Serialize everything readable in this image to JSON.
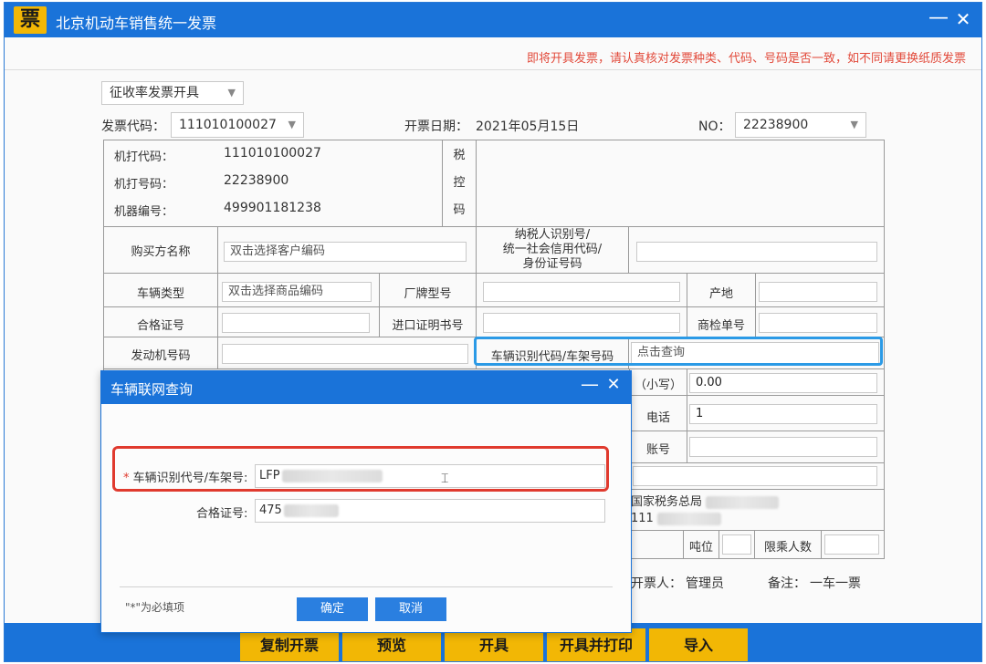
{
  "window": {
    "logo": "票",
    "title": "北京机动车销售统一发票",
    "minimize": "—",
    "close": "✕"
  },
  "notice": "即将开具发票，请认真核对发票种类、代码、号码是否一致，如不同请更换纸质发票",
  "invoice_type": "征收率发票开具",
  "header": {
    "code_label": "发票代码：",
    "code_value": "111010100027",
    "date_label": "开票日期：",
    "date_value": "2021年05月15日",
    "no_label": "NO：",
    "no_value": "22238900"
  },
  "machine": {
    "code_label": "机打代码：",
    "code_value": "111010100027",
    "number_label": "机打号码：",
    "number_value": "22238900",
    "serial_label": "机器编号：",
    "serial_value": "499901181238",
    "tax_label": [
      "税",
      "控",
      "码"
    ]
  },
  "fields": {
    "buyer_name_label": "购买方名称",
    "buyer_name_placeholder": "双击选择客户编码",
    "taxpayer_label_1": "纳税人识别号/",
    "taxpayer_label_2": "统一社会信用代码/",
    "taxpayer_label_3": "身份证号码",
    "vehicle_type_label": "车辆类型",
    "vehicle_type_placeholder": "双击选择商品编码",
    "brand_model_label": "厂牌型号",
    "origin_label": "产地",
    "certificate_label": "合格证号",
    "import_cert_label": "进口证明书号",
    "inspection_label": "商检单号",
    "engine_label": "发动机号码",
    "vin_label": "车辆识别代码/车架号码",
    "vin_placeholder": "点击查询",
    "small_label": "（小写）",
    "small_value": "0.00",
    "phone_label": "电话",
    "phone_value": "1",
    "account_label": "账号",
    "tax_office": "国家税务总局",
    "tax_office_code": "111",
    "tonnage_label": "吨位",
    "passengers_label": "限乘人数"
  },
  "footer": {
    "issuer_label": "开票人：",
    "issuer_value": "管理员",
    "remark_label": "备注：",
    "remark_value": "一车一票"
  },
  "toolbar": {
    "copy": "复制开票",
    "preview": "预览",
    "issue": "开具",
    "issue_print": "开具并打印",
    "import": "导入"
  },
  "dialog": {
    "title": "车辆联网查询",
    "minimize": "—",
    "close": "✕",
    "required_mark": "*",
    "vin_label": "车辆识别代号/车架号:",
    "vin_value": "LFP",
    "cert_label": "合格证号:",
    "cert_value": "475",
    "required_note": "\"*\"为必填项",
    "ok": "确定",
    "cancel": "取消"
  },
  "colors": {
    "titlebar": "#1a73d9",
    "accent_yellow": "#f2b705",
    "notice_red": "#e24a3b",
    "highlight_blue": "#2b9ae6",
    "highlight_red": "#e03a2e"
  }
}
